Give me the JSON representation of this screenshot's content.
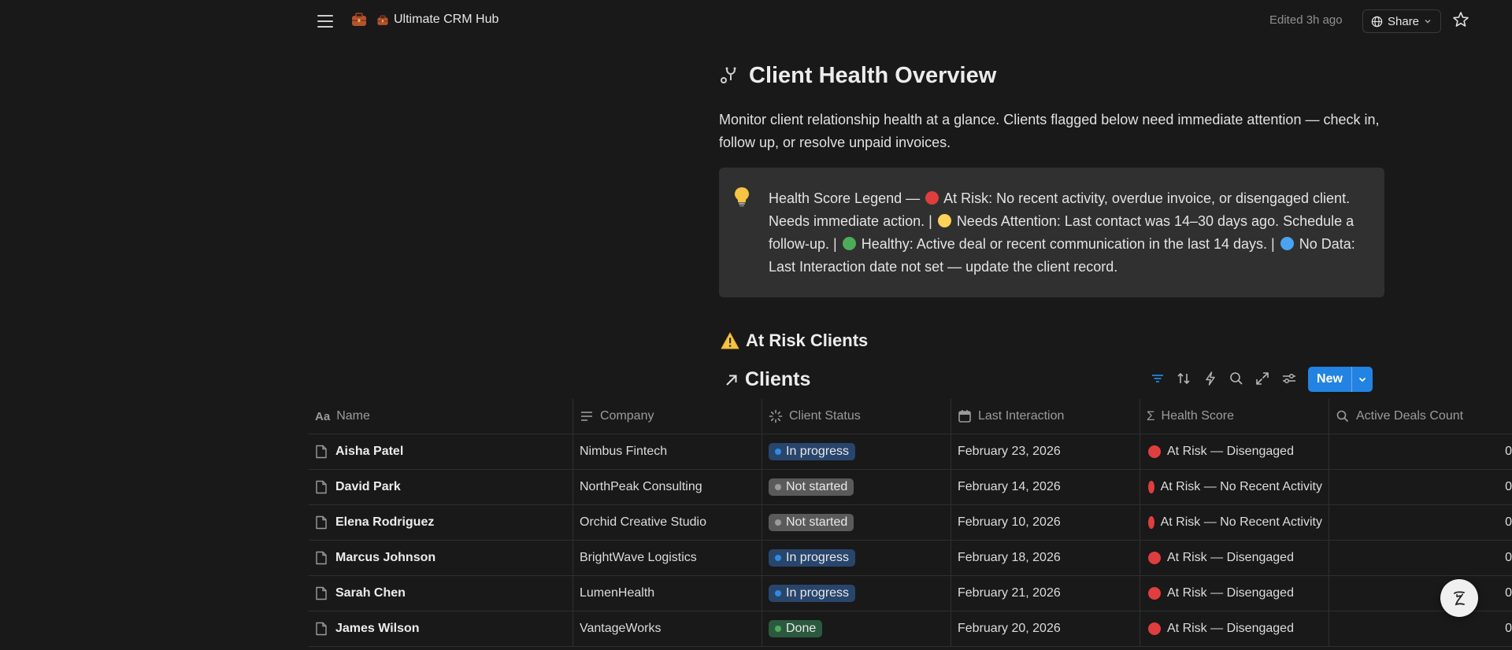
{
  "topbar": {
    "workspace_title": "Ultimate CRM Hub",
    "edited": "Edited 3h ago",
    "share_label": "Share"
  },
  "page": {
    "title": "Client Health Overview",
    "intro": "Monitor client relationship health at a glance. Clients flagged below need immediate attention — check in, follow up, or resolve unpaid invoices."
  },
  "callout": {
    "lead": "Health Score Legend —",
    "at_risk": "At Risk: No recent activity, overdue invoice, or disengaged client. Needs immediate action. |",
    "needs_attention": "Needs Attention: Last contact was 14–30 days ago. Schedule a follow-up. |",
    "healthy": "Healthy: Active deal or recent communication in the last 14 days. |",
    "no_data": "No Data: Last Interaction date not set — update the client record."
  },
  "colors": {
    "red": "#e03e3e",
    "yellow": "#ffd25a",
    "green": "#4dab5a",
    "blue": "#4aa3f0",
    "accent": "#2383e2"
  },
  "section": {
    "heading": "At Risk Clients",
    "database_title": "Clients",
    "new_label": "New"
  },
  "table": {
    "headers": {
      "name": "Name",
      "company": "Company",
      "status": "Client Status",
      "last_interaction": "Last Interaction",
      "health": "Health Score",
      "deals": "Active Deals Count"
    },
    "rows": [
      {
        "name": "Aisha Patel",
        "company": "Nimbus Fintech",
        "status": "In progress",
        "date": "February 23, 2026",
        "health": "At Risk — Disengaged",
        "deals": "0"
      },
      {
        "name": "David Park",
        "company": "NorthPeak Consulting",
        "status": "Not started",
        "date": "February 14, 2026",
        "health": "At Risk — No Recent Activity",
        "deals": "0"
      },
      {
        "name": "Elena Rodriguez",
        "company": "Orchid Creative Studio",
        "status": "Not started",
        "date": "February 10, 2026",
        "health": "At Risk — No Recent Activity",
        "deals": "0"
      },
      {
        "name": "Marcus Johnson",
        "company": "BrightWave Logistics",
        "status": "In progress",
        "date": "February 18, 2026",
        "health": "At Risk — Disengaged",
        "deals": "0"
      },
      {
        "name": "Sarah Chen",
        "company": "LumenHealth",
        "status": "In progress",
        "date": "February 21, 2026",
        "health": "At Risk — Disengaged",
        "deals": "0"
      },
      {
        "name": "James Wilson",
        "company": "VantageWorks",
        "status": "Done",
        "date": "February 20, 2026",
        "health": "At Risk — Disengaged",
        "deals": "0"
      }
    ]
  }
}
